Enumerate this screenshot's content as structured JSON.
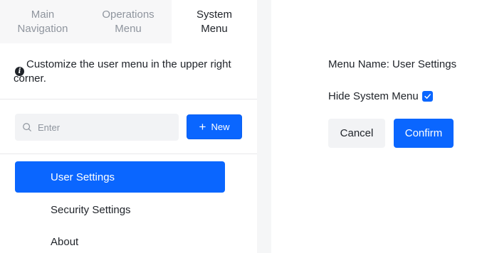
{
  "tabs": [
    {
      "label": "Main\nNavigation",
      "active": false
    },
    {
      "label": "Operations\nMenu",
      "active": false
    },
    {
      "label": "System\nMenu",
      "active": true
    }
  ],
  "hint": {
    "icon": "info-icon",
    "text": "Customize the user menu in the upper right corner."
  },
  "search": {
    "placeholder": "Enter",
    "value": "",
    "icon": "search-icon"
  },
  "new_button": {
    "label": "New",
    "icon": "plus-icon"
  },
  "menu_items": [
    {
      "label": "User Settings",
      "active": true
    },
    {
      "label": "Security Settings",
      "active": false
    },
    {
      "label": "About",
      "active": false
    }
  ],
  "detail": {
    "menu_name_label": "Menu Name: User Settings",
    "hide_system_menu_label": "Hide System Menu",
    "hide_system_menu_checked": true,
    "cancel_label": "Cancel",
    "confirm_label": "Confirm"
  },
  "colors": {
    "accent": "#0a66ff",
    "tab_bg": "#f7f7f8",
    "muted_text": "#8f959e"
  }
}
